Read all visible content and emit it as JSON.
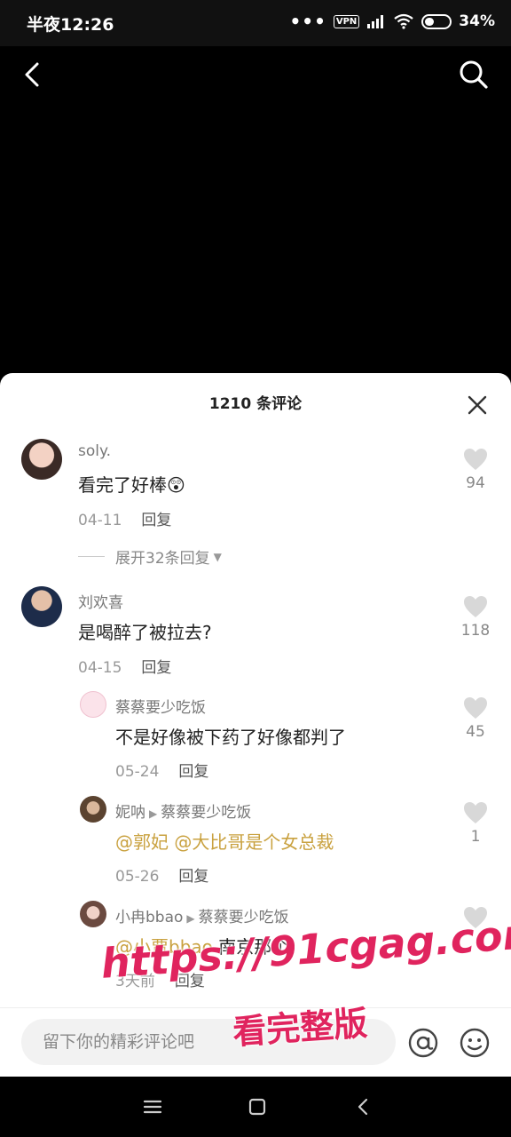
{
  "status_bar": {
    "time": "半夜12:26",
    "dots": "•••",
    "vpn": "VPN",
    "battery": "34%"
  },
  "sheet": {
    "title": "1210 条评论",
    "input_placeholder": "留下你的精彩评论吧"
  },
  "comments": [
    {
      "user": "soly.",
      "text": "看完了好棒😲",
      "date": "04-11",
      "reply": "回复",
      "likes": "94",
      "expand": "展开32条回复"
    },
    {
      "user": "刘欢喜",
      "text": "是喝醉了被拉去?",
      "date": "04-15",
      "reply": "回复",
      "likes": "118"
    }
  ],
  "replies": [
    {
      "user": "蔡蔡要少吃饭",
      "text": "不是好像被下药了好像都判了",
      "date": "05-24",
      "reply": "回复",
      "likes": "45"
    },
    {
      "user": "妮呐",
      "target": "蔡蔡要少吃饭",
      "mention": "@郭妃 @大比哥是个女总裁",
      "date": "05-26",
      "reply": "回复",
      "likes": "1"
    },
    {
      "user": "小冉bbao",
      "target": "蔡蔡要少吃饭",
      "mention": "@小贾bbao",
      "text": " 南京那个",
      "date": "3天前",
      "reply": "回复",
      "likes": ""
    }
  ],
  "watermark": {
    "url": "https://91cgag.com",
    "sub": "看完整版"
  },
  "colors": {
    "accent_mention": "#c9a13f",
    "watermark": "#e0245e"
  },
  "icons": [
    "back-icon",
    "search-icon",
    "close-icon",
    "heart-icon",
    "at-icon",
    "emoji-icon",
    "menu-icon",
    "home-icon",
    "nav-back-icon"
  ]
}
